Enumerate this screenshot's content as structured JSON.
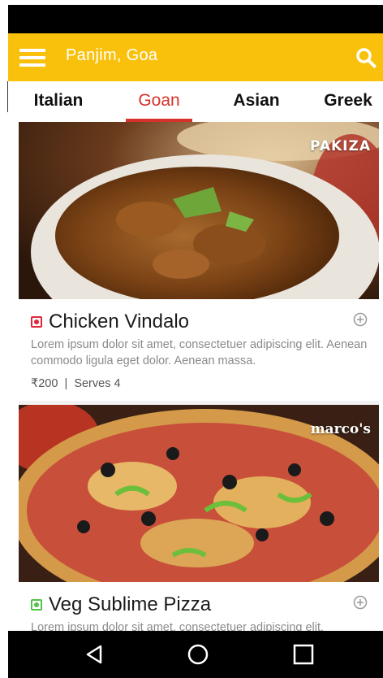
{
  "app_bar": {
    "location": "Panjim, Goa"
  },
  "tabs": [
    {
      "label": "Italian",
      "active": false
    },
    {
      "label": "Goan",
      "active": true
    },
    {
      "label": "Asian",
      "active": false
    },
    {
      "label": "Greek",
      "active": false
    }
  ],
  "dishes": [
    {
      "restaurant": "PAKIZA",
      "name": "Chicken Vindalo",
      "type": "non-veg",
      "description": "Lorem ipsum dolor sit amet, consectetuer adipiscing elit. Aenean commodo ligula eget dolor. Aenean massa.",
      "price": "₹200",
      "serves": "Serves 4"
    },
    {
      "restaurant": "marco's",
      "name": "Veg Sublime Pizza",
      "type": "veg",
      "description": "Lorem ipsum dolor sit amet, consectetuer adipiscing elit."
    }
  ],
  "colors": {
    "app_bar": "#f9c10c",
    "accent": "#d6322c",
    "non_veg": "#e0263b",
    "veg": "#54c24a"
  },
  "icons": {
    "menu": "hamburger-icon",
    "search": "search-icon",
    "add": "add-circle-icon",
    "back": "back-triangle-icon",
    "home": "home-circle-icon",
    "recents": "recents-square-icon"
  }
}
